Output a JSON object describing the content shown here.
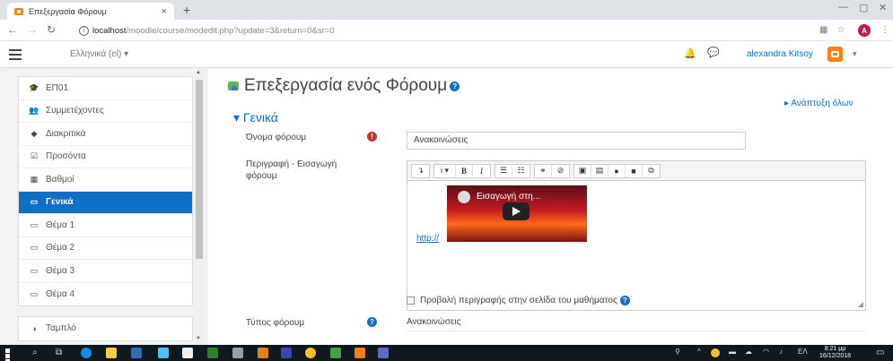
{
  "browser": {
    "tab_title": "Επεξεργασία Φόρουμ",
    "tab_close": "×",
    "new_tab": "+",
    "url_host": "localhost",
    "url_path": "/moodle/course/modedit.php?update=3&return=0&sr=0",
    "profile_initial": "A"
  },
  "header": {
    "language": "Ελληνικά (el) ▾",
    "user_name": "alexandra Kitsoy"
  },
  "sidebar": {
    "items": [
      {
        "label": "ΕΠ01",
        "icon": "🎓"
      },
      {
        "label": "Συμμετέχοντες",
        "icon": "👥"
      },
      {
        "label": "Διακριτικά",
        "icon": "◆"
      },
      {
        "label": "Προσόντα",
        "icon": "☑"
      },
      {
        "label": "Βαθμοί",
        "icon": "▦"
      },
      {
        "label": "Γενικά",
        "icon": "▭",
        "active": true
      },
      {
        "label": "Θέμα 1",
        "icon": "▭"
      },
      {
        "label": "Θέμα 2",
        "icon": "▭"
      },
      {
        "label": "Θέμα 3",
        "icon": "▭"
      },
      {
        "label": "Θέμα 4",
        "icon": "▭"
      }
    ],
    "dashboard": {
      "label": "Ταμπλό",
      "icon": "◑"
    }
  },
  "main": {
    "title": "Επεξεργασία ενός Φόρουμ",
    "expand_all": "▸ Ανάπτυξη όλων",
    "section": "▾ Γενικά",
    "forum_name_label": "Όνομα φόρουμ",
    "forum_name_value": "Ανακοινώσεις",
    "description_label": "Περιγραφή - Εισαγωγή φόρουμ",
    "video_title": "Εισαγωγή στη...",
    "link_text": "http://",
    "show_description_label": "Προβολή περιγραφής στην σελίδα του μαθήματος",
    "forum_type_label": "Τύπος φόρουμ",
    "forum_type_value": "Ανακοινώσεις"
  },
  "taskbar": {
    "language": "ΕΛ",
    "time": "8:21 μμ",
    "date": "16/12/2018"
  },
  "colors": {
    "accent": "#0f6fc5",
    "moodle_orange": "#f98012",
    "required": "#c9302c"
  }
}
